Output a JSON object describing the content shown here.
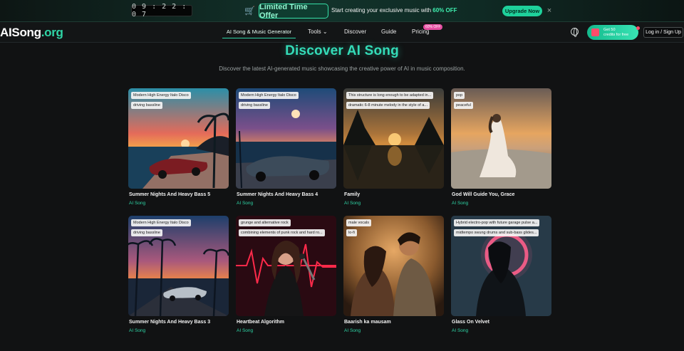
{
  "promo": {
    "timer": "0 9 : 2 2 : 0 7",
    "offer_label": "Limited Time Offer",
    "text": "Start creating your exclusive music with ",
    "highlight": "60% OFF",
    "upgrade_label": "Upgrade Now",
    "close_glyph": "×"
  },
  "nav": {
    "logo_main": "AISong",
    "logo_suffix": ".org",
    "items": [
      {
        "label": "AI Song & Music Generator"
      },
      {
        "label": "Tools ⌄"
      },
      {
        "label": "Discover"
      },
      {
        "label": "Guide"
      },
      {
        "label": "Pricing"
      }
    ],
    "pricing_badge": "60% OFF",
    "credits_line1": "Get 50",
    "credits_line2": "credits for free",
    "login_label": "Log in / Sign Up"
  },
  "hero": {
    "title": "Discover AI Song",
    "subtitle": "Discover the latest AI-generated music showcasing the creative power of AI in music composition."
  },
  "cards": [
    {
      "tags": [
        "Modern High Energy Italo Disco",
        "driving bassline"
      ],
      "title": "Summer Nights And Heavy Bass 5",
      "sub": "AI Song"
    },
    {
      "tags": [
        "Modern High Energy Italo Disco",
        "driving bassline"
      ],
      "title": "Summer Nights And Heavy Bass 4",
      "sub": "AI Song"
    },
    {
      "tags": [
        "This structure is long enough to be adapted in...",
        "dramatic 6-8 minute melody in the style of a..."
      ],
      "title": "Family",
      "sub": "AI Song"
    },
    {
      "tags": [
        "pop",
        "peaceful"
      ],
      "title": "God Will Guide You, Grace",
      "sub": "AI Song"
    },
    {
      "tags": [
        "Modern High Energy Italo Disco",
        "driving bassline"
      ],
      "title": "Summer Nights And Heavy Bass 3",
      "sub": "AI Song"
    },
    {
      "tags": [
        "grunge and alternative rock",
        "combining elements of punk rock and hard ro..."
      ],
      "title": "Heartbeat Algorithm",
      "sub": "AI Song"
    },
    {
      "tags": [
        "male vocals",
        "lo-fi"
      ],
      "title": "Baarish ka mausam",
      "sub": "AI Song"
    },
    {
      "tags": [
        "Hybrid electro-pop with future garage pulse a...",
        "midtempo swung drums and sub-bass glides..."
      ],
      "title": "Glass On Velvet",
      "sub": "AI Song"
    }
  ]
}
